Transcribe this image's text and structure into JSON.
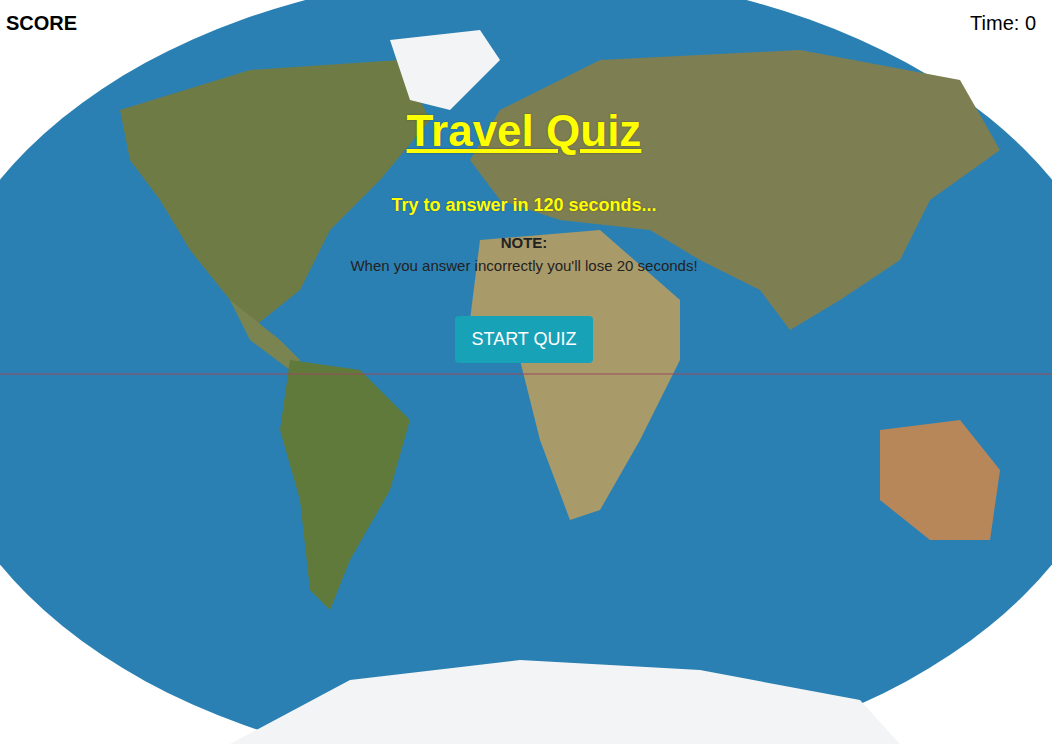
{
  "header": {
    "score_label": "SCORE",
    "time": "Time: 0"
  },
  "title": "Travel Quiz",
  "subtitle": "Try to answer in 120 seconds...",
  "note": {
    "label": "NOTE:",
    "text": "When you answer incorrectly you'll lose 20 seconds!"
  },
  "start_button": {
    "label": "START QUIZ"
  }
}
